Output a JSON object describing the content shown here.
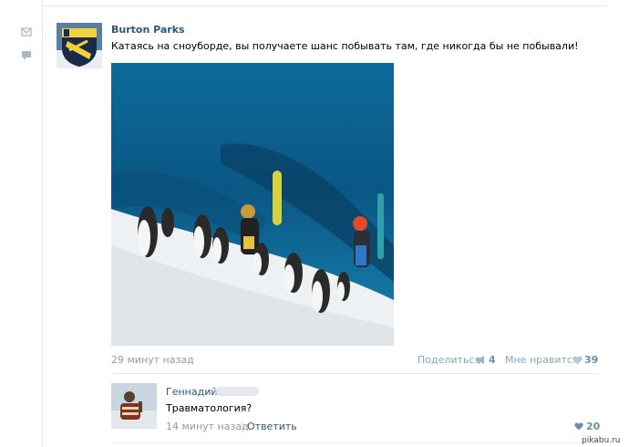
{
  "post": {
    "author": "Burton Parks",
    "text": "Катаясь на сноуборде, вы получаете шанс побывать там, где никогда бы не побывали!",
    "time": "29 минут назад",
    "share_label": "Поделиться",
    "share_count": "4",
    "like_label": "Мне нравится",
    "like_count": "39"
  },
  "comment": {
    "author": "Геннадий",
    "text": "Травматология?",
    "time": "14 минут назад",
    "separator": "|",
    "reply_label": "Ответить",
    "like_count": "20"
  },
  "watermark": "pikabu.ru",
  "icons": [
    "mail-icon",
    "comment-icon",
    "megaphone-icon",
    "heart-icon"
  ],
  "colors": {
    "link": "#2b587a",
    "muted": "#999999",
    "action": "#8aa4bd"
  }
}
